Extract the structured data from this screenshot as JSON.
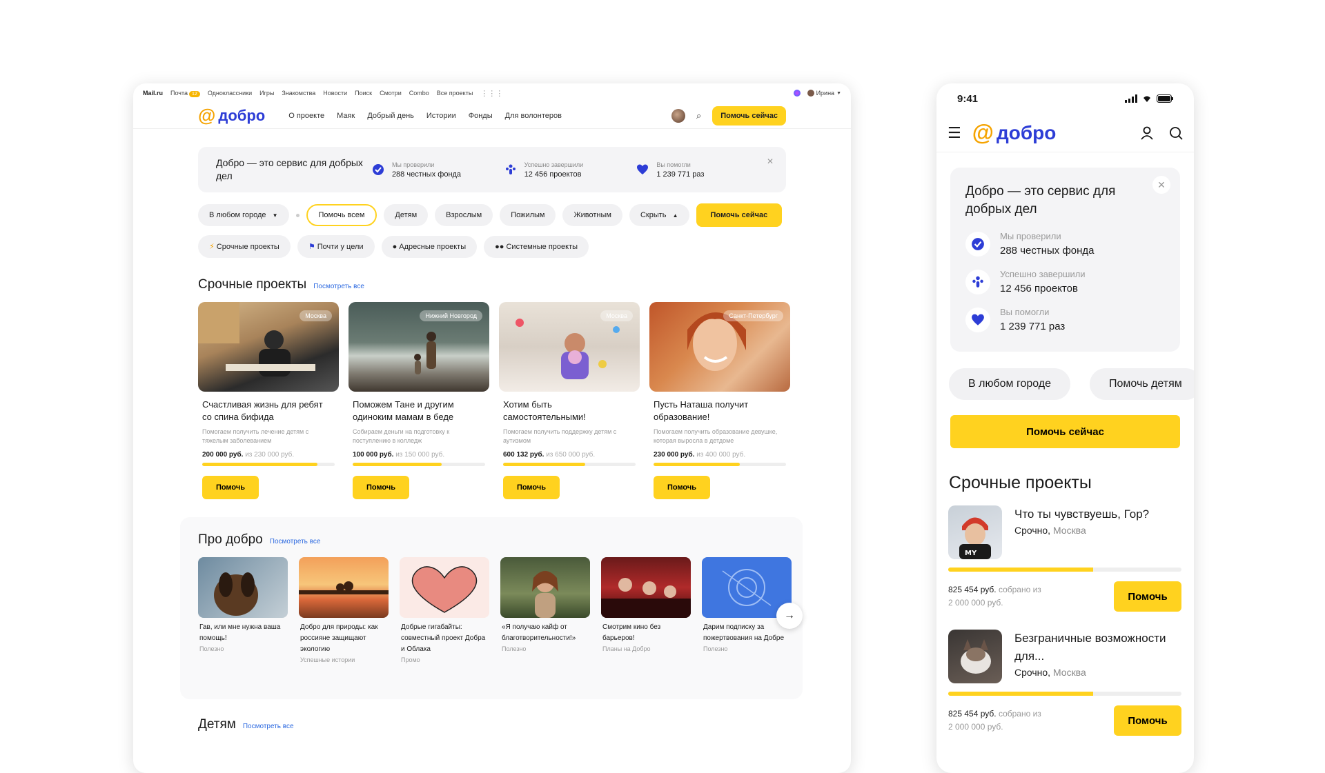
{
  "portal": {
    "brand": "Mail.ru",
    "links": [
      "Почта",
      "Одноклассники",
      "Игры",
      "Знакомства",
      "Новости",
      "Поиск",
      "Смотри",
      "Combo",
      "Все проекты"
    ],
    "mail_badge": "12",
    "user": "Ирина"
  },
  "nav": {
    "logo": "добро",
    "items": [
      "О проекте",
      "Маяк",
      "Добрый день",
      "Истории",
      "Фонды",
      "Для волонтеров"
    ],
    "help_now": "Помочь сейчас"
  },
  "info": {
    "title": "Добро — это сервис для добрых дел",
    "stats": [
      {
        "label": "Мы проверили",
        "value": "288 честных фонда"
      },
      {
        "label": "Успешно завершили",
        "value": "12 456 проектов"
      },
      {
        "label": "Вы помогли",
        "value": "1 239 771 раз"
      }
    ]
  },
  "filters": {
    "city": "В любом городе",
    "categories": [
      "Помочь всем",
      "Детям",
      "Взрослым",
      "Пожилым",
      "Животным"
    ],
    "hide": "Скрыть",
    "help_now": "Помочь сейчас",
    "types": [
      "Срочные проекты",
      "Почти у цели",
      "Адресные проекты",
      "Системные проекты"
    ]
  },
  "urgent": {
    "title": "Срочные проекты",
    "see_all": "Посмотреть все",
    "help_label": "Помочь",
    "cards": [
      {
        "city": "Москва",
        "title": "Счастливая жизнь для ребят со спина бифида",
        "desc": "Помогаем получить лечение детям с тяжелым заболеванием",
        "amount": "200 000 руб.",
        "goal": "из 230 000 руб.",
        "progress": 0.87
      },
      {
        "city": "Нижний Новгород",
        "title": "Поможем Тане и другим одиноким мамам в беде",
        "desc": "Собираем деньги на подготовку к поступлению в колледж",
        "amount": "100 000 руб.",
        "goal": "из 150 000 руб.",
        "progress": 0.67
      },
      {
        "city": "Москва",
        "title": "Хотим быть самостоятельными!",
        "desc": "Помогаем получить поддержку детям с аутизмом",
        "amount": "600 132 руб.",
        "goal": "из 650 000 руб.",
        "progress": 0.62
      },
      {
        "city": "Санкт-Петербург",
        "title": "Пусть Наташа получит образование!",
        "desc": "Помогаем получить образование девушке, которая выросла в детдоме",
        "amount": "230 000 руб.",
        "goal": "из 400 000 руб.",
        "progress": 0.65
      }
    ]
  },
  "pro": {
    "title": "Про добро",
    "see_all": "Посмотреть все",
    "cards": [
      {
        "title": "Гав, или мне нужна ваша помощь!",
        "cat": "Полезно"
      },
      {
        "title": "Добро для природы: как россияне защищают экологию",
        "cat": "Успешные истории"
      },
      {
        "title": "Добрые гигабайты: совместный проект Добра и Облака",
        "cat": "Промо"
      },
      {
        "title": "«Я получаю кайф от благотворительности!»",
        "cat": "Полезно"
      },
      {
        "title": "Смотрим кино без барьеров!",
        "cat": "Планы на Добро"
      },
      {
        "title": "Дарим подписку за пожертвования на Добре",
        "cat": "Полезно"
      }
    ]
  },
  "kids": {
    "title": "Детям",
    "see_all": "Посмотреть все"
  },
  "mobile": {
    "time": "9:41",
    "logo": "добро",
    "info_title": "Добро — это сервис для добрых дел",
    "stats": [
      {
        "label": "Мы проверили",
        "value": "288 честных фонда"
      },
      {
        "label": "Успешно завершили",
        "value": "12 456 проектов"
      },
      {
        "label": "Вы помогли",
        "value": "1 239 771 раз"
      }
    ],
    "chip_city": "В любом городе",
    "chip_kids": "Помочь детям",
    "help_now": "Помочь сейчас",
    "urgent_title": "Срочные проекты",
    "help_label": "Помочь",
    "projects": [
      {
        "title": "Что ты чувствуешь, Гор?",
        "status": "Срочно,",
        "city": "Москва",
        "amount": "825 454 руб.",
        "collected": "собрано из",
        "goal": "2 000 000 руб.",
        "progress": 0.62
      },
      {
        "title": "Безграничные возможности для...",
        "status": "Срочно,",
        "city": "Москва",
        "amount": "825 454 руб.",
        "collected": "собрано из",
        "goal": "2 000 000 руб.",
        "progress": 0.62
      }
    ]
  },
  "colors": {
    "accent": "#ffd21f",
    "brand": "#2d3dd6",
    "at": "#f5a300"
  }
}
